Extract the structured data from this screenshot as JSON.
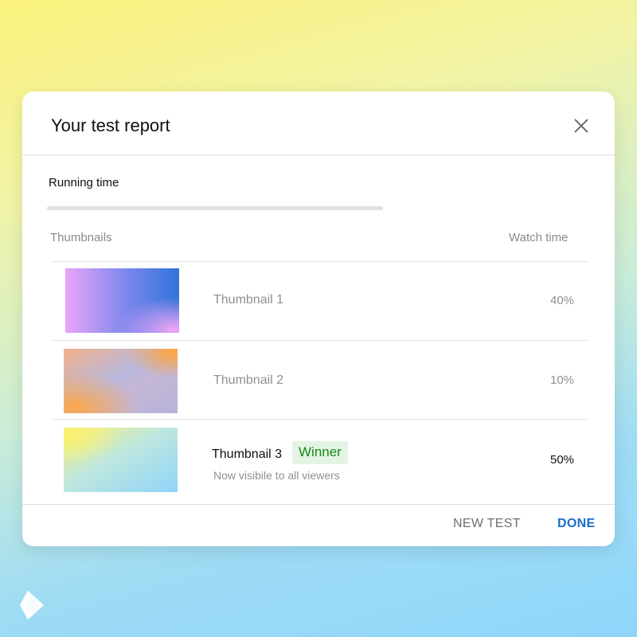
{
  "dialog": {
    "title": "Your test report",
    "close_icon": "close-icon"
  },
  "running_time": {
    "label": "Running time",
    "progress": 1.0
  },
  "table": {
    "headers": {
      "thumbnails": "Thumbnails",
      "watch_time": "Watch time"
    },
    "rows": [
      {
        "label": "Thumbnail 1",
        "value": "40%",
        "winner": false
      },
      {
        "label": "Thumbnail 2",
        "value": "10%",
        "winner": false
      },
      {
        "label": "Thumbnail 3",
        "value": "50%",
        "winner": true,
        "badge": "Winner",
        "note": "Now visibile to all viewers"
      }
    ]
  },
  "footer": {
    "new_test_label": "NEW TEST",
    "done_label": "DONE"
  },
  "colors": {
    "accent": "#1a6fc9",
    "winner_badge_text": "#168a16",
    "winner_badge_bg": "#e4f4e4"
  },
  "brand": {
    "icon": "brand-logo-icon"
  }
}
